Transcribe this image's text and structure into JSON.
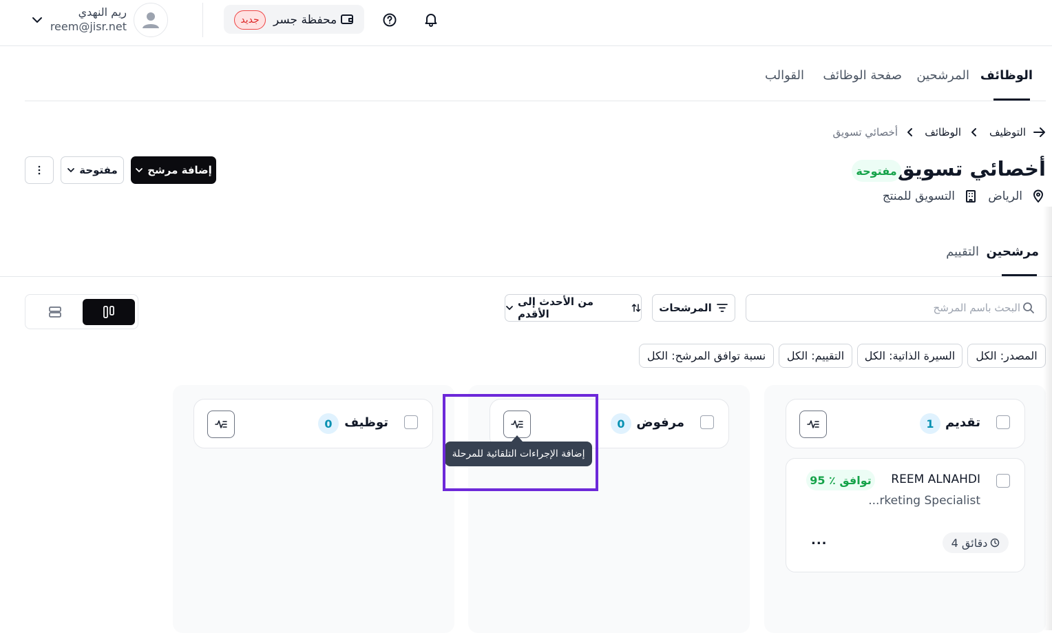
{
  "user": {
    "name": "ريم النهدي",
    "email": "reem@jisr.net"
  },
  "wallet": {
    "label": "محفظة جسر",
    "badge": "جديد"
  },
  "main_tabs": [
    {
      "label": "الوظائف",
      "active": true
    },
    {
      "label": "المرشحين",
      "active": false
    },
    {
      "label": "صفحة الوظائف",
      "active": false
    },
    {
      "label": "القوالب",
      "active": false
    }
  ],
  "breadcrumb": [
    "التوظيف",
    "الوظائف",
    "أخصائي تسويق"
  ],
  "job": {
    "title": "أخصائي تسويق",
    "status": "مفتوحة",
    "location": "الرياض",
    "department": "التسويق للمنتج"
  },
  "actions": {
    "add_candidate": "إضافة مرشح",
    "status_dropdown": "مفتوحة"
  },
  "sub_tabs": [
    {
      "label": "مرشحين",
      "active": true
    },
    {
      "label": "التقييم",
      "active": false
    }
  ],
  "toolbar": {
    "search_placeholder": "البحث باسم المرشح",
    "filters_label": "المرشحات",
    "sort_label": "من الأحدث إلى الأقدم"
  },
  "filter_chips": [
    "المصدر: الكل",
    "السيرة الذاتية: الكل",
    "التقييم: الكل",
    "نسبة توافق المرشح: الكل"
  ],
  "stages": [
    {
      "name": "تقديم",
      "count": "1"
    },
    {
      "name": "مرفوض",
      "count": "0"
    },
    {
      "name": "توظيف",
      "count": "0"
    }
  ],
  "candidate": {
    "name": "REEM ALNAHDI",
    "role": "...rketing Specialist",
    "match": "توافق ٪ 95",
    "time": "4 دقائق",
    "more": "..."
  },
  "tooltip": "إضافة الإجراءات التلقائية للمرحلة",
  "colors": {
    "primary": "#0b0b0f",
    "success": "#16a34a",
    "count": "#0891b2",
    "highlight": "#6d28d9",
    "badge_red": "#dc2626"
  }
}
